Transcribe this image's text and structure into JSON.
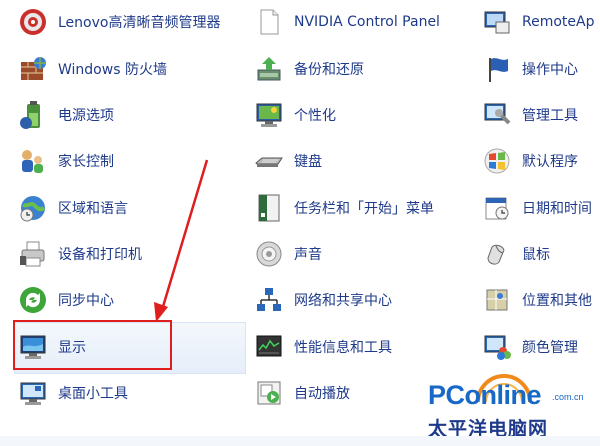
{
  "items": {
    "lenovo_audio": "Lenovo高清晰音频管理器",
    "nvidia": "NVIDIA Control Panel",
    "remoteapp": "RemoteAp",
    "firewall": "Windows 防火墙",
    "backup": "备份和还原",
    "action_center": "操作中心",
    "power": "电源选项",
    "personalize": "个性化",
    "admin_tools": "管理工具",
    "parental": "家长控制",
    "keyboard": "键盘",
    "default_programs": "默认程序",
    "region": "区域和语言",
    "taskbar": "任务栏和「开始」菜单",
    "datetime": "日期和时间",
    "devices": "设备和打印机",
    "sound": "声音",
    "mouse": "鼠标",
    "sync": "同步中心",
    "network": "网络和共享中心",
    "location": "位置和其他",
    "display": "显示",
    "performance": "性能信息和工具",
    "color": "颜色管理",
    "gadgets": "桌面小工具",
    "autoplay": "自动播放"
  },
  "watermark": {
    "brand": "PConline",
    "domain": ".com.cn",
    "chinese": "太平洋电脑网"
  },
  "colors": {
    "label": "#1e3a8a",
    "highlight": "#e01e1e",
    "brand": "#1768c7"
  }
}
